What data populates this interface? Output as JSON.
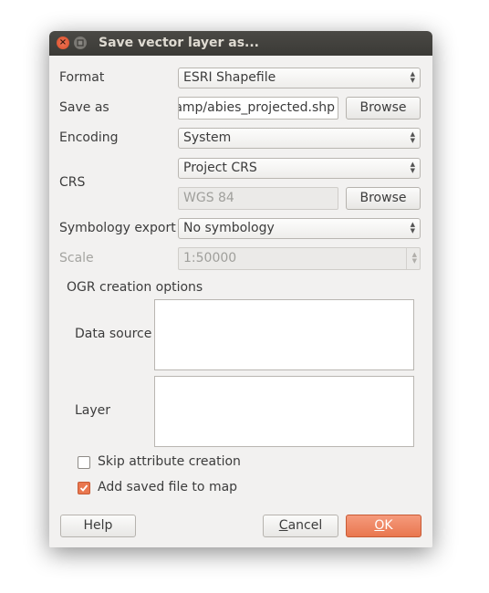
{
  "window": {
    "title": "Save vector layer as..."
  },
  "form": {
    "format_label": "Format",
    "format_value": "ESRI Shapefile",
    "save_as_label": "Save as",
    "save_as_value": "camp/abies_projected.shp",
    "browse_label": "Browse",
    "encoding_label": "Encoding",
    "encoding_value": "System",
    "crs_label": "CRS",
    "crs_value": "Project CRS",
    "crs_name": "WGS 84",
    "crs_browse_label": "Browse",
    "symbology_label": "Symbology export",
    "symbology_value": "No symbology",
    "scale_label": "Scale",
    "scale_value": "1:50000"
  },
  "ogr": {
    "title": "OGR creation options",
    "data_source_label": "Data source",
    "data_source_value": "",
    "layer_label": "Layer",
    "layer_value": ""
  },
  "options": {
    "skip_attr_label": "Skip attribute creation",
    "skip_attr_checked": false,
    "add_to_map_label": "Add saved file to map",
    "add_to_map_checked": true
  },
  "buttons": {
    "help": "Help",
    "cancel_mnemonic": "C",
    "cancel_rest": "ancel",
    "ok_mnemonic": "O",
    "ok_rest": "K"
  },
  "colors": {
    "accent": "#e9774f",
    "titlebar": "#3b3a36",
    "window_bg": "#f2f1f0"
  }
}
